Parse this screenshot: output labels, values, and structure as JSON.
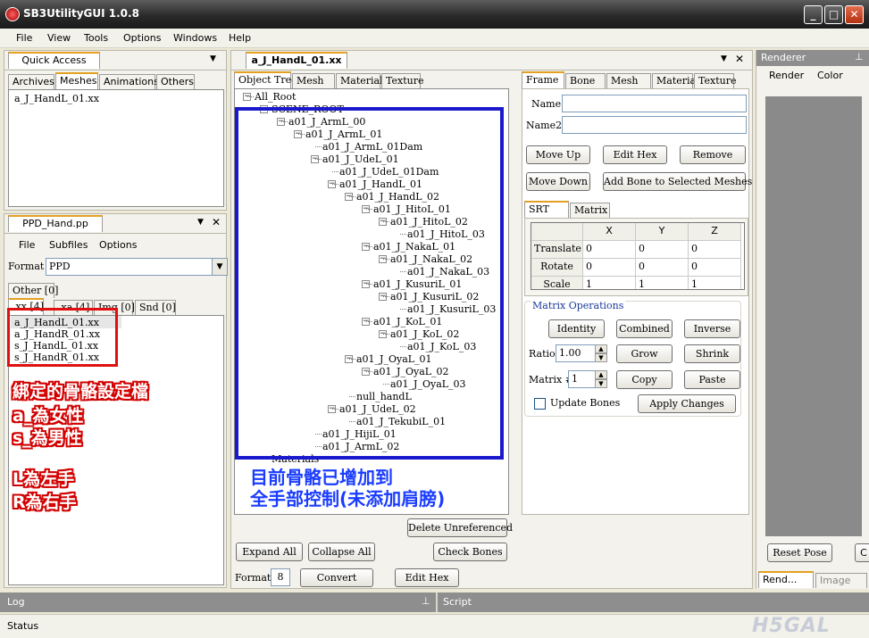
{
  "window": {
    "title": "SB3UtilityGUI 1.0.8"
  },
  "menu": [
    "File",
    "View",
    "Tools",
    "Options",
    "Windows",
    "Help"
  ],
  "quick_access": {
    "title": "Quick Access",
    "tabs": [
      "Archives",
      "Meshes",
      "Animations",
      "Others"
    ],
    "items": [
      "a_J_HandL_01.xx"
    ]
  },
  "pp_panel": {
    "title": "PPD_Hand.pp",
    "menu": [
      "File",
      "Subfiles",
      "Options"
    ],
    "format_label": "Format",
    "format_value": "PPD",
    "other_tab": "Other [0]",
    "tabs": [
      ".xx [4]",
      ".xa [4]",
      "Img [0]",
      "Snd [0]"
    ],
    "files": [
      "a_J_HandL_01.xx",
      "a_J_HandR_01.xx",
      "s_J_HandL_01.xx",
      "s_J_HandR_01.xx"
    ]
  },
  "annotations": {
    "left": [
      "綁定的骨骼設定檔",
      "a_為女性",
      "s_為男性",
      "L為左手",
      "R為右手"
    ],
    "center": [
      "目前骨骼已增加到",
      "全手部控制(未添加肩膀)"
    ]
  },
  "object_panel": {
    "doc_tab": "a_J_HandL_01.xx",
    "tabs": [
      "Object Tree",
      "Mesh",
      "Material",
      "Texture"
    ],
    "tree": [
      {
        "label": "All_Root",
        "depth": 0
      },
      {
        "label": "SCENE_ROOT",
        "depth": 1
      },
      {
        "label": "a01_J_ArmL_00",
        "depth": 2
      },
      {
        "label": "a01_J_ArmL_01",
        "depth": 3
      },
      {
        "label": "a01_J_ArmL_01Dam",
        "depth": 4
      },
      {
        "label": "a01_J_UdeL_01",
        "depth": 4
      },
      {
        "label": "a01_J_UdeL_01Dam",
        "depth": 5
      },
      {
        "label": "a01_J_HandL_01",
        "depth": 5
      },
      {
        "label": "a01_J_HandL_02",
        "depth": 6
      },
      {
        "label": "a01_J_HitoL_01",
        "depth": 7
      },
      {
        "label": "a01_J_HitoL_02",
        "depth": 8
      },
      {
        "label": "a01_J_HitoL_03",
        "depth": 9
      },
      {
        "label": "a01_J_NakaL_01",
        "depth": 7
      },
      {
        "label": "a01_J_NakaL_02",
        "depth": 8
      },
      {
        "label": "a01_J_NakaL_03",
        "depth": 9
      },
      {
        "label": "a01_J_KusuriL_01",
        "depth": 7
      },
      {
        "label": "a01_J_KusuriL_02",
        "depth": 8
      },
      {
        "label": "a01_J_KusuriL_03",
        "depth": 9
      },
      {
        "label": "a01_J_KoL_01",
        "depth": 7
      },
      {
        "label": "a01_J_KoL_02",
        "depth": 8
      },
      {
        "label": "a01_J_KoL_03",
        "depth": 9
      },
      {
        "label": "a01_J_OyaL_01",
        "depth": 6
      },
      {
        "label": "a01_J_OyaL_02",
        "depth": 7
      },
      {
        "label": "a01_J_OyaL_03",
        "depth": 8
      },
      {
        "label": "null_handL",
        "depth": 6
      },
      {
        "label": "a01_J_UdeL_02",
        "depth": 5
      },
      {
        "label": "a01_J_TekubiL_01",
        "depth": 6
      },
      {
        "label": "a01_J_HijiL_01",
        "depth": 4
      },
      {
        "label": "a01_J_ArmL_02",
        "depth": 4
      },
      {
        "label": "Materials",
        "depth": 1
      }
    ],
    "buttons": {
      "delete_unref": "Delete Unreferenced",
      "expand_all": "Expand All",
      "collapse_all": "Collapse All",
      "check_bones": "Check Bones",
      "convert": "Convert",
      "edit_hex": "Edit Hex"
    },
    "format_label": "Format",
    "format_value": "8"
  },
  "props": {
    "tabs": [
      "Frame",
      "Bone",
      "Mesh",
      "Material",
      "Texture"
    ],
    "name_label": "Name",
    "name2_label": "Name2",
    "buttons": {
      "move_up": "Move Up",
      "edit_hex": "Edit Hex",
      "remove": "Remove",
      "move_down": "Move Down",
      "add_bone": "Add Bone to Selected Meshes"
    },
    "srt_tabs": [
      "SRT",
      "Matrix"
    ],
    "grid": {
      "cols": [
        "X",
        "Y",
        "Z"
      ],
      "rows": [
        {
          "label": "Translate",
          "values": [
            "0",
            "0",
            "0"
          ]
        },
        {
          "label": "Rotate",
          "values": [
            "0",
            "0",
            "0"
          ]
        },
        {
          "label": "Scale",
          "values": [
            "1",
            "1",
            "1"
          ]
        }
      ]
    },
    "matrix_ops": {
      "title": "Matrix Operations",
      "identity": "Identity",
      "combined": "Combined",
      "inverse": "Inverse",
      "ratio_label": "Ratio",
      "ratio_value": "1.00",
      "grow": "Grow",
      "shrink": "Shrink",
      "matrix_label": "Matrix #",
      "matrix_value": "1",
      "copy": "Copy",
      "paste": "Paste",
      "update_bones": "Update Bones",
      "apply": "Apply Changes"
    }
  },
  "renderer": {
    "title": "Renderer",
    "menu": [
      "Render",
      "Color"
    ],
    "reset_pose": "Reset Pose",
    "bottom_tabs": [
      "Rend...",
      "Image"
    ]
  },
  "bottom": {
    "log": "Log",
    "script": "Script",
    "status": "Status"
  },
  "watermark": "H5GAL",
  "colors": {
    "annotation_box": "#1a1acc",
    "red_box": "#e01010",
    "tab_accent": "#e4a020"
  }
}
